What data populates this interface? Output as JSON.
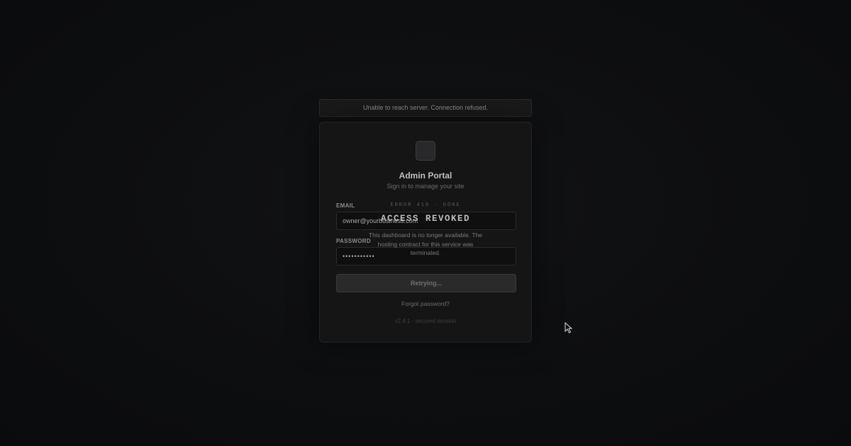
{
  "banner": {
    "message": "Unable to reach server. Connection refused."
  },
  "login": {
    "title": "Admin Portal",
    "subtitle": "Sign in to manage your site",
    "email_label": "EMAIL",
    "email_value": "owner@yourbusiness.com",
    "password_label": "PASSWORD",
    "password_value": "•••••••••••",
    "submit_label": "Retrying...",
    "forgot_label": "Forgot password?",
    "version": "v2.4.1 · secured session"
  },
  "overlay": {
    "code": "ERROR 410 · GONE",
    "heading": "ACCESS REVOKED",
    "message": "This dashboard is no longer available. The hosting contract for this service was terminated."
  },
  "icons": {
    "logo": "site-logo-icon",
    "cursor": "mouse-pointer-icon"
  },
  "colors": {
    "background": "#0c0d0f",
    "card": "#151516",
    "banner": "#1a1a1b"
  }
}
